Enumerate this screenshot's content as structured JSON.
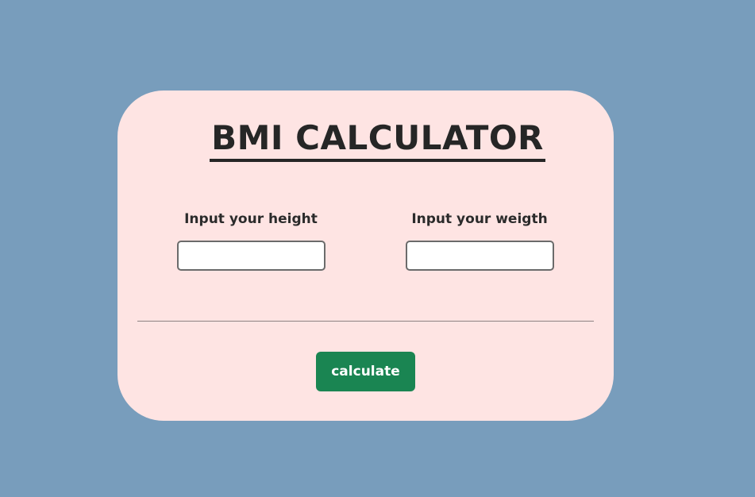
{
  "colors": {
    "page_background": "#789dbc",
    "card_background": "#fee4e3",
    "button_background": "#1a8552",
    "title_text": "#262626"
  },
  "card": {
    "title": "BMI CALCULATOR",
    "height_field": {
      "label": "Input your height",
      "value": "",
      "placeholder": ""
    },
    "weight_field": {
      "label": "Input your weigth",
      "value": "",
      "placeholder": ""
    },
    "calculate_button": {
      "label": "calculate"
    }
  }
}
